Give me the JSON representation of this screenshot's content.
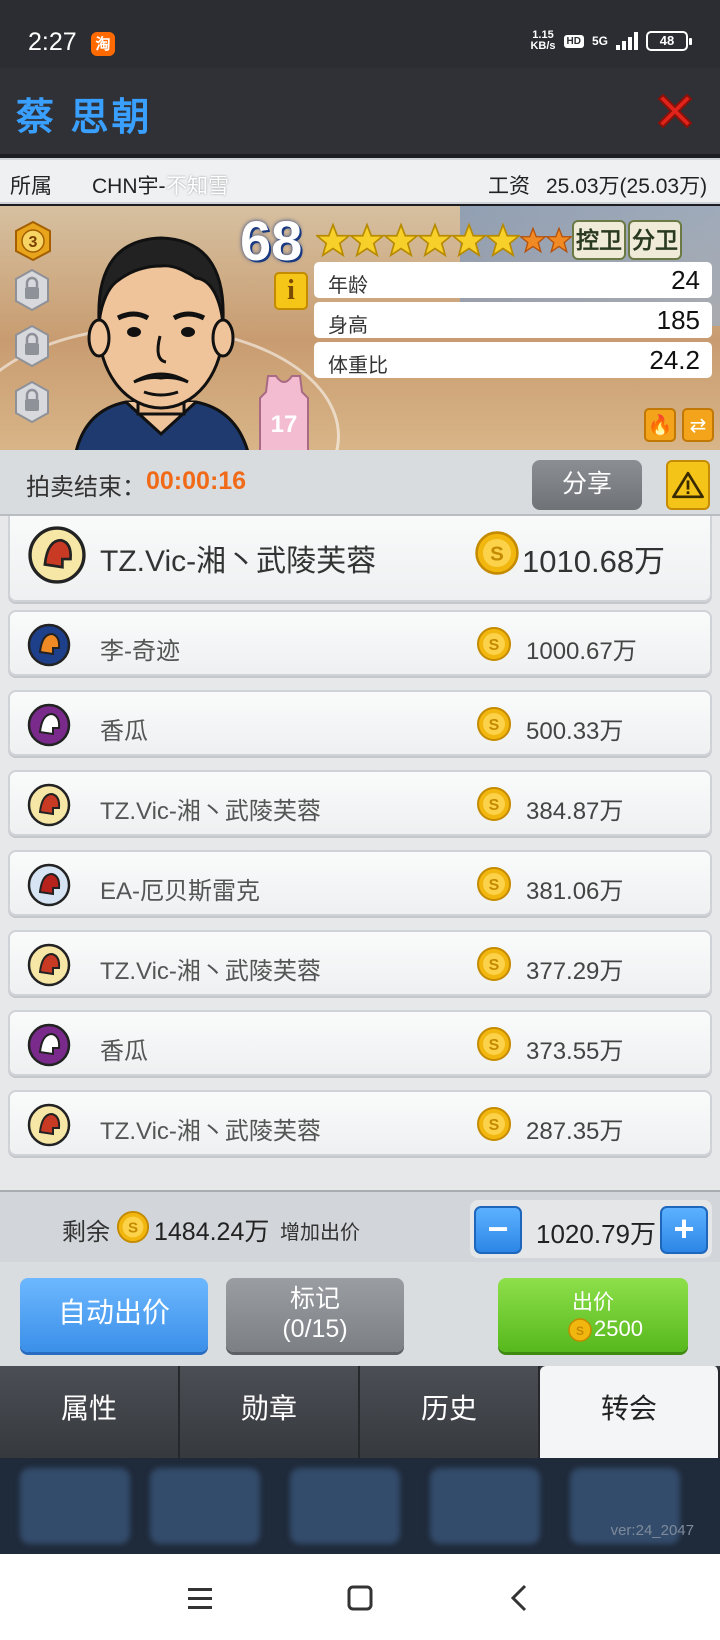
{
  "status_bar": {
    "time": "2:27",
    "app_badge": "淘",
    "speed_value": "1.15",
    "speed_unit": "KB/s",
    "hd": "HD",
    "network": "5G",
    "battery": "48"
  },
  "header": {
    "player_name": "蔡 思朝",
    "close_icon": "close-x-icon"
  },
  "info_row": {
    "team_label": "所属",
    "team_value": "CHN宇-",
    "team_owner": "不知雪",
    "salary_label": "工资",
    "salary_value": "25.03万(25.03万)"
  },
  "player_card": {
    "level_badge": "3",
    "overall": "68",
    "stars_full": 6,
    "stars_orange": 2,
    "positions": [
      "控卫",
      "分卫"
    ],
    "jersey_number": "17",
    "info_button": "i",
    "attributes": [
      {
        "label": "年龄",
        "value": "24"
      },
      {
        "label": "身高",
        "value": "185"
      },
      {
        "label": "体重比",
        "value": "24.2"
      }
    ]
  },
  "auction": {
    "label": "拍卖结束：",
    "time_left": "00:00:16",
    "share_label": "分享"
  },
  "bids": [
    {
      "team": "TZ.Vic-湘丶武陵芙蓉",
      "amount": "1010.68万",
      "logo": "spartan-helmet-logo"
    },
    {
      "team": "李-奇迹",
      "amount": "1000.67万",
      "logo": "phoenix-logo"
    },
    {
      "team": "香瓜",
      "amount": "500.33万",
      "logo": "elephant-logo"
    },
    {
      "team": "TZ.Vic-湘丶武陵芙蓉",
      "amount": "384.87万",
      "logo": "spartan-helmet-logo"
    },
    {
      "team": "EA-厄贝斯雷克",
      "amount": "381.06万",
      "logo": "bull-logo"
    },
    {
      "team": "TZ.Vic-湘丶武陵芙蓉",
      "amount": "377.29万",
      "logo": "spartan-helmet-logo"
    },
    {
      "team": "香瓜",
      "amount": "373.55万",
      "logo": "elephant-logo"
    },
    {
      "team": "TZ.Vic-湘丶武陵芙蓉",
      "amount": "287.35万",
      "logo": "spartan-helmet-logo"
    }
  ],
  "bid_panel": {
    "remain_label": "剩余",
    "remain_value": "1484.24万",
    "raise_label": "增加出价",
    "raise_value": "1020.79万",
    "minus": "−",
    "plus": "+"
  },
  "actions": {
    "auto_bid": "自动出价",
    "mark_label": "标记",
    "mark_count": "(0/15)",
    "bid_label": "出价",
    "bid_cost": "2500"
  },
  "tabs": [
    {
      "label": "属性",
      "active": false
    },
    {
      "label": "勋章",
      "active": false
    },
    {
      "label": "历史",
      "active": false
    },
    {
      "label": "转会",
      "active": true
    }
  ],
  "footer": {
    "version": "ver:24_2047"
  },
  "colors": {
    "accent_blue": "#3aa0ff",
    "timer_orange": "#f06a18",
    "bid_green": "#56b81c",
    "close_red": "#e0241b",
    "coin_gold": "#f2b70f"
  }
}
